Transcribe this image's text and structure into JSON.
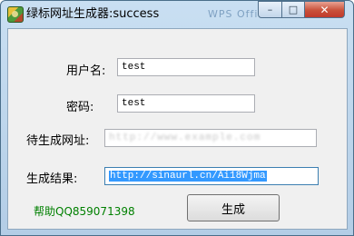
{
  "window": {
    "title": "绿标网址生成器:success",
    "ghost_title": "WPS Office",
    "controls": {
      "minimize": "–",
      "maximize": "□",
      "close": "✕"
    },
    "icon": "app-logo-icon"
  },
  "form": {
    "username": {
      "label": "用户名:",
      "value": "test"
    },
    "password": {
      "label": "密码:",
      "value": "test"
    },
    "url": {
      "label": "待生成网址:",
      "value": "http://www.example.com"
    },
    "result": {
      "label": "生成结果:",
      "value": "http://sinaurl.cn/Ai18Wjma"
    }
  },
  "footer": {
    "help": "帮助QQ859071398",
    "generate_label": "生成"
  },
  "colors": {
    "help_text": "#008000",
    "selection": "#3399ff",
    "close_button": "#c0392b"
  }
}
